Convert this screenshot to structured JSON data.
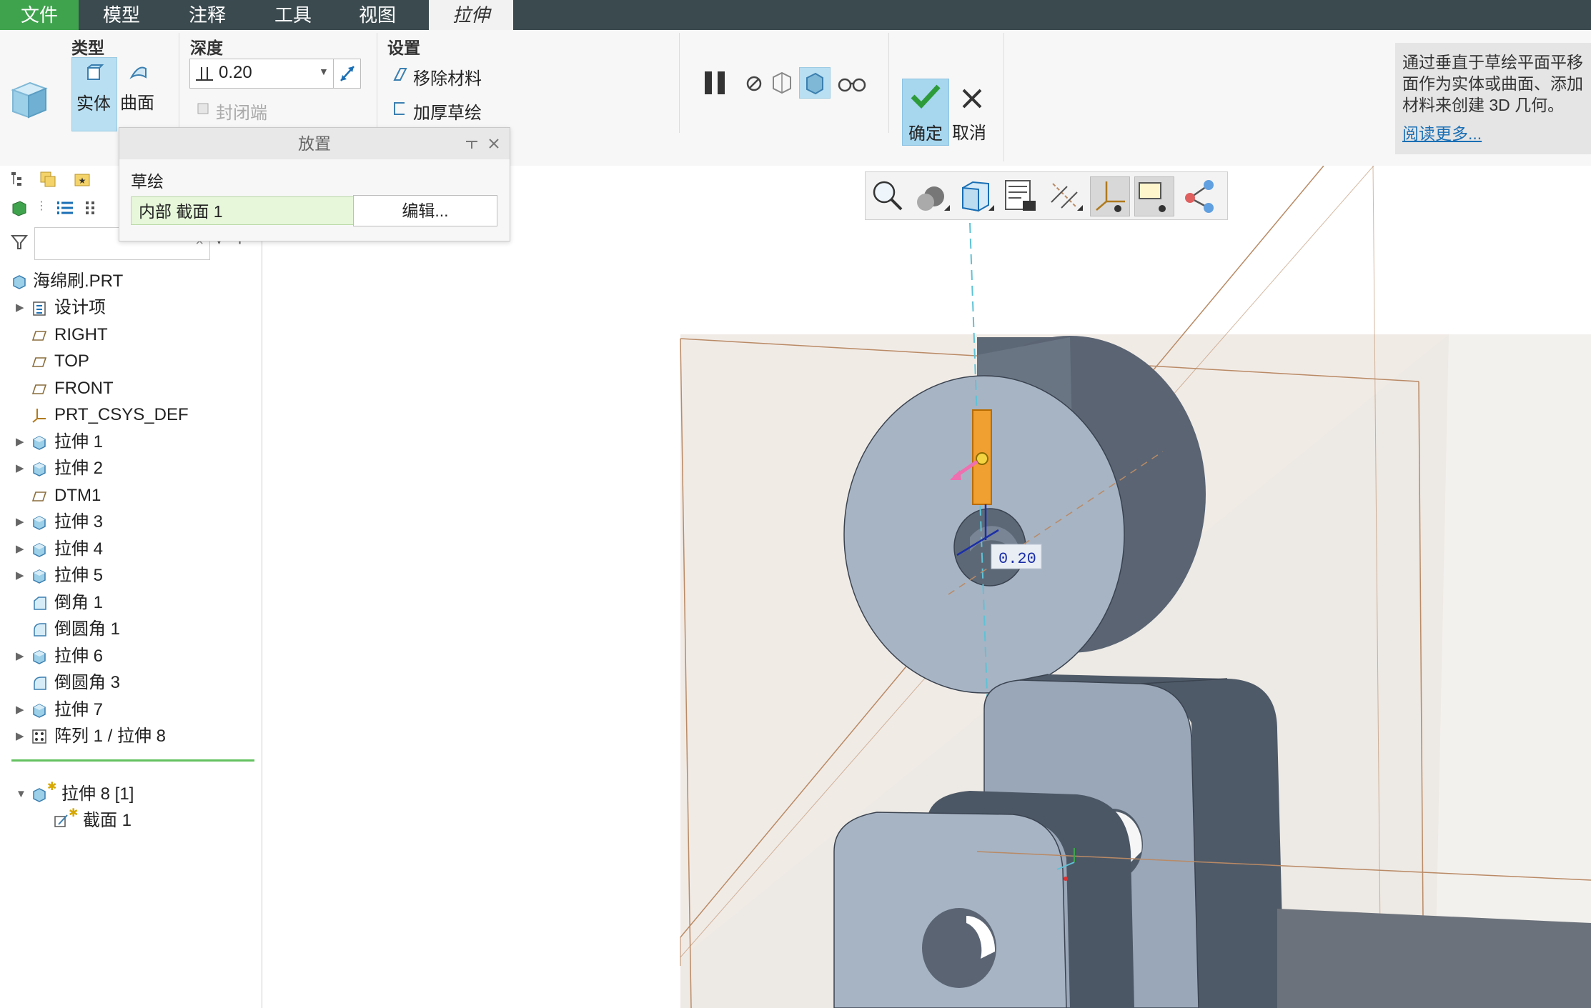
{
  "menu": {
    "items": [
      {
        "label": "文件",
        "id": "file"
      },
      {
        "label": "模型",
        "id": "model"
      },
      {
        "label": "注释",
        "id": "annotate"
      },
      {
        "label": "工具",
        "id": "tools"
      },
      {
        "label": "视图",
        "id": "view"
      },
      {
        "label": "拉伸",
        "id": "extrude"
      }
    ]
  },
  "ribbon": {
    "type_title": "类型",
    "solid_label": "实体",
    "surface_label": "曲面",
    "depth_title": "深度",
    "depth_value": "0.20",
    "cap_ends_label": "封闭端",
    "settings_title": "设置",
    "remove_material_label": "移除材料",
    "thicken_sketch_label": "加厚草绘",
    "ok_label": "确定",
    "cancel_label": "取消",
    "info_text": "通过垂直于草绘平面平移\n面作为实体或曲面、添加\n材料来创建 3D 几何。",
    "info_link": "阅读更多..."
  },
  "placement": {
    "title": "放置",
    "sketch_label": "草绘",
    "sketch_value": "内部 截面 1",
    "edit_label": "编辑..."
  },
  "tree": {
    "root": "海绵刷.PRT",
    "items": [
      {
        "label": "设计项",
        "icon": "design-items-icon",
        "expandable": true
      },
      {
        "label": "RIGHT",
        "icon": "datum-plane-icon",
        "expandable": false
      },
      {
        "label": "TOP",
        "icon": "datum-plane-icon",
        "expandable": false
      },
      {
        "label": "FRONT",
        "icon": "datum-plane-icon",
        "expandable": false
      },
      {
        "label": "PRT_CSYS_DEF",
        "icon": "csys-icon",
        "expandable": false
      },
      {
        "label": "拉伸 1",
        "icon": "extrude-icon",
        "expandable": true
      },
      {
        "label": "拉伸 2",
        "icon": "extrude-icon",
        "expandable": true
      },
      {
        "label": "DTM1",
        "icon": "datum-plane-icon",
        "expandable": false
      },
      {
        "label": "拉伸 3",
        "icon": "extrude-icon",
        "expandable": true
      },
      {
        "label": "拉伸 4",
        "icon": "extrude-icon",
        "expandable": true
      },
      {
        "label": "拉伸 5",
        "icon": "extrude-icon",
        "expandable": true
      },
      {
        "label": "倒角 1",
        "icon": "chamfer-icon",
        "expandable": false
      },
      {
        "label": "倒圆角 1",
        "icon": "round-icon",
        "expandable": false
      },
      {
        "label": "拉伸 6",
        "icon": "extrude-icon",
        "expandable": true
      },
      {
        "label": "倒圆角 3",
        "icon": "round-icon",
        "expandable": false
      },
      {
        "label": "拉伸 7",
        "icon": "extrude-icon",
        "expandable": true
      },
      {
        "label": "阵列 1 / 拉伸 8",
        "icon": "pattern-icon",
        "expandable": true
      }
    ],
    "active_feature": "拉伸 8 [1]",
    "active_child": "截面 1"
  },
  "viewport": {
    "dimension_label": "0.20"
  },
  "colors": {
    "menubar": "#3b4a4f",
    "file_menu": "#3fa34d",
    "accent_blue": "#1a6fb5",
    "model_gray": "#8e9aab",
    "sketch_orange": "#f0a030"
  }
}
